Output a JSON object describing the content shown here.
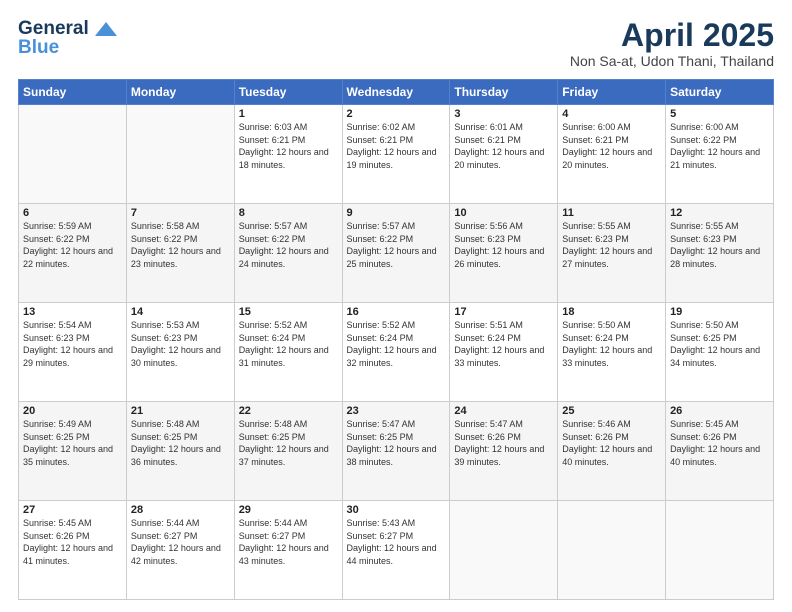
{
  "header": {
    "logo_line1": "General",
    "logo_line2": "Blue",
    "title": "April 2025",
    "subtitle": "Non Sa-at, Udon Thani, Thailand"
  },
  "weekdays": [
    "Sunday",
    "Monday",
    "Tuesday",
    "Wednesday",
    "Thursday",
    "Friday",
    "Saturday"
  ],
  "weeks": [
    [
      {
        "day": "",
        "sunrise": "",
        "sunset": "",
        "daylight": ""
      },
      {
        "day": "",
        "sunrise": "",
        "sunset": "",
        "daylight": ""
      },
      {
        "day": "1",
        "sunrise": "Sunrise: 6:03 AM",
        "sunset": "Sunset: 6:21 PM",
        "daylight": "Daylight: 12 hours and 18 minutes."
      },
      {
        "day": "2",
        "sunrise": "Sunrise: 6:02 AM",
        "sunset": "Sunset: 6:21 PM",
        "daylight": "Daylight: 12 hours and 19 minutes."
      },
      {
        "day": "3",
        "sunrise": "Sunrise: 6:01 AM",
        "sunset": "Sunset: 6:21 PM",
        "daylight": "Daylight: 12 hours and 20 minutes."
      },
      {
        "day": "4",
        "sunrise": "Sunrise: 6:00 AM",
        "sunset": "Sunset: 6:21 PM",
        "daylight": "Daylight: 12 hours and 20 minutes."
      },
      {
        "day": "5",
        "sunrise": "Sunrise: 6:00 AM",
        "sunset": "Sunset: 6:22 PM",
        "daylight": "Daylight: 12 hours and 21 minutes."
      }
    ],
    [
      {
        "day": "6",
        "sunrise": "Sunrise: 5:59 AM",
        "sunset": "Sunset: 6:22 PM",
        "daylight": "Daylight: 12 hours and 22 minutes."
      },
      {
        "day": "7",
        "sunrise": "Sunrise: 5:58 AM",
        "sunset": "Sunset: 6:22 PM",
        "daylight": "Daylight: 12 hours and 23 minutes."
      },
      {
        "day": "8",
        "sunrise": "Sunrise: 5:57 AM",
        "sunset": "Sunset: 6:22 PM",
        "daylight": "Daylight: 12 hours and 24 minutes."
      },
      {
        "day": "9",
        "sunrise": "Sunrise: 5:57 AM",
        "sunset": "Sunset: 6:22 PM",
        "daylight": "Daylight: 12 hours and 25 minutes."
      },
      {
        "day": "10",
        "sunrise": "Sunrise: 5:56 AM",
        "sunset": "Sunset: 6:23 PM",
        "daylight": "Daylight: 12 hours and 26 minutes."
      },
      {
        "day": "11",
        "sunrise": "Sunrise: 5:55 AM",
        "sunset": "Sunset: 6:23 PM",
        "daylight": "Daylight: 12 hours and 27 minutes."
      },
      {
        "day": "12",
        "sunrise": "Sunrise: 5:55 AM",
        "sunset": "Sunset: 6:23 PM",
        "daylight": "Daylight: 12 hours and 28 minutes."
      }
    ],
    [
      {
        "day": "13",
        "sunrise": "Sunrise: 5:54 AM",
        "sunset": "Sunset: 6:23 PM",
        "daylight": "Daylight: 12 hours and 29 minutes."
      },
      {
        "day": "14",
        "sunrise": "Sunrise: 5:53 AM",
        "sunset": "Sunset: 6:23 PM",
        "daylight": "Daylight: 12 hours and 30 minutes."
      },
      {
        "day": "15",
        "sunrise": "Sunrise: 5:52 AM",
        "sunset": "Sunset: 6:24 PM",
        "daylight": "Daylight: 12 hours and 31 minutes."
      },
      {
        "day": "16",
        "sunrise": "Sunrise: 5:52 AM",
        "sunset": "Sunset: 6:24 PM",
        "daylight": "Daylight: 12 hours and 32 minutes."
      },
      {
        "day": "17",
        "sunrise": "Sunrise: 5:51 AM",
        "sunset": "Sunset: 6:24 PM",
        "daylight": "Daylight: 12 hours and 33 minutes."
      },
      {
        "day": "18",
        "sunrise": "Sunrise: 5:50 AM",
        "sunset": "Sunset: 6:24 PM",
        "daylight": "Daylight: 12 hours and 33 minutes."
      },
      {
        "day": "19",
        "sunrise": "Sunrise: 5:50 AM",
        "sunset": "Sunset: 6:25 PM",
        "daylight": "Daylight: 12 hours and 34 minutes."
      }
    ],
    [
      {
        "day": "20",
        "sunrise": "Sunrise: 5:49 AM",
        "sunset": "Sunset: 6:25 PM",
        "daylight": "Daylight: 12 hours and 35 minutes."
      },
      {
        "day": "21",
        "sunrise": "Sunrise: 5:48 AM",
        "sunset": "Sunset: 6:25 PM",
        "daylight": "Daylight: 12 hours and 36 minutes."
      },
      {
        "day": "22",
        "sunrise": "Sunrise: 5:48 AM",
        "sunset": "Sunset: 6:25 PM",
        "daylight": "Daylight: 12 hours and 37 minutes."
      },
      {
        "day": "23",
        "sunrise": "Sunrise: 5:47 AM",
        "sunset": "Sunset: 6:25 PM",
        "daylight": "Daylight: 12 hours and 38 minutes."
      },
      {
        "day": "24",
        "sunrise": "Sunrise: 5:47 AM",
        "sunset": "Sunset: 6:26 PM",
        "daylight": "Daylight: 12 hours and 39 minutes."
      },
      {
        "day": "25",
        "sunrise": "Sunrise: 5:46 AM",
        "sunset": "Sunset: 6:26 PM",
        "daylight": "Daylight: 12 hours and 40 minutes."
      },
      {
        "day": "26",
        "sunrise": "Sunrise: 5:45 AM",
        "sunset": "Sunset: 6:26 PM",
        "daylight": "Daylight: 12 hours and 40 minutes."
      }
    ],
    [
      {
        "day": "27",
        "sunrise": "Sunrise: 5:45 AM",
        "sunset": "Sunset: 6:26 PM",
        "daylight": "Daylight: 12 hours and 41 minutes."
      },
      {
        "day": "28",
        "sunrise": "Sunrise: 5:44 AM",
        "sunset": "Sunset: 6:27 PM",
        "daylight": "Daylight: 12 hours and 42 minutes."
      },
      {
        "day": "29",
        "sunrise": "Sunrise: 5:44 AM",
        "sunset": "Sunset: 6:27 PM",
        "daylight": "Daylight: 12 hours and 43 minutes."
      },
      {
        "day": "30",
        "sunrise": "Sunrise: 5:43 AM",
        "sunset": "Sunset: 6:27 PM",
        "daylight": "Daylight: 12 hours and 44 minutes."
      },
      {
        "day": "",
        "sunrise": "",
        "sunset": "",
        "daylight": ""
      },
      {
        "day": "",
        "sunrise": "",
        "sunset": "",
        "daylight": ""
      },
      {
        "day": "",
        "sunrise": "",
        "sunset": "",
        "daylight": ""
      }
    ]
  ]
}
